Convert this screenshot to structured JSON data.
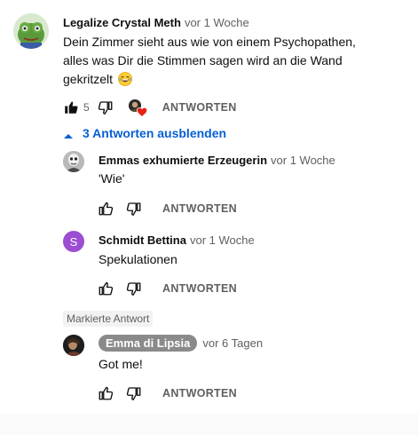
{
  "reply_label": "ANTWORTEN",
  "colors": {
    "link": "#065fd4",
    "heart": "#e62117",
    "secondary": "#606060"
  },
  "main_comment": {
    "author": "Legalize Crystal Meth",
    "time": "vor 1 Woche",
    "text_line1": "Dein Zimmer sieht aus wie von einem Psychopathen,",
    "text_line2": "alles was Dir die Stimmen sagen wird an die Wand",
    "text_line3": "gekritzelt",
    "emoji": "😂",
    "like_count": "5",
    "icons": [
      "thumbs-up-filled-icon",
      "thumbs-down-icon",
      "creator-heart-icon"
    ]
  },
  "toggle_replies": {
    "label": "3 Antworten ausblenden",
    "icon": "chevron-up-icon"
  },
  "replies": [
    {
      "author": "Emmas exhumierte Erzeugerin",
      "time": "vor 1 Woche",
      "text": "'Wie'"
    },
    {
      "author": "Schmidt Bettina",
      "time": "vor 1 Woche",
      "text": "Spekulationen",
      "avatar_letter": "S",
      "avatar_color": "#9c4dd2"
    },
    {
      "pinned_label": "Markierte Antwort",
      "author": "Emma di Lipsia",
      "time": "vor 6 Tagen",
      "text": "Got me!"
    }
  ]
}
